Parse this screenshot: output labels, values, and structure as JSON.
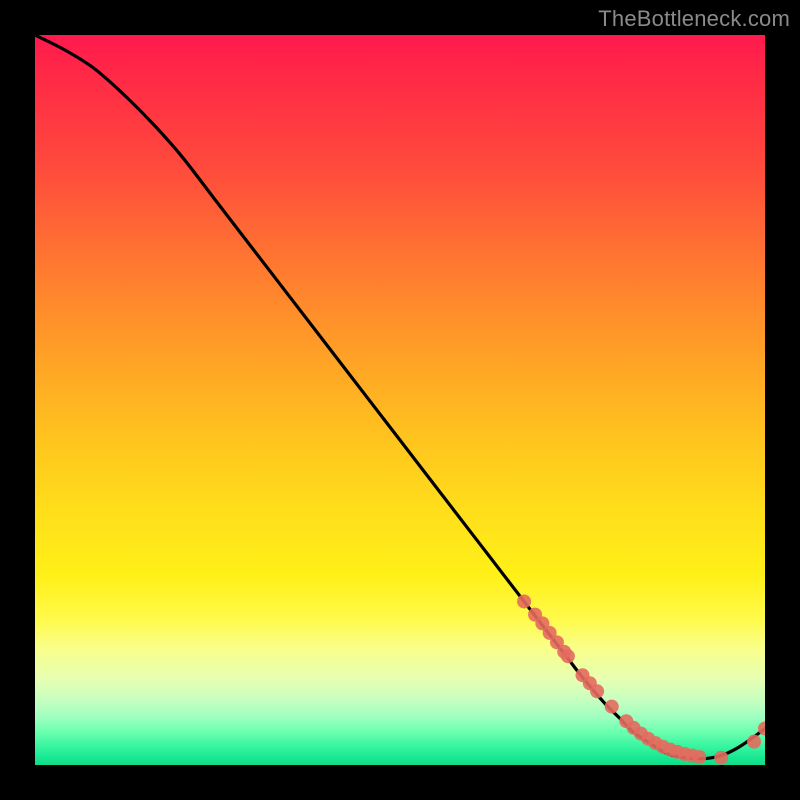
{
  "watermark": "TheBottleneck.com",
  "colors": {
    "background": "#000000",
    "curve": "#000000",
    "marker": "#e46a5e",
    "gradient_top": "#ff1a4d",
    "gradient_bottom": "#10dc88"
  },
  "chart_data": {
    "type": "line",
    "title": "",
    "xlabel": "",
    "ylabel": "",
    "xlim": [
      0,
      100
    ],
    "ylim": [
      0,
      100
    ],
    "grid": false,
    "legend": false,
    "series": [
      {
        "name": "curve",
        "x": [
          0,
          4,
          8,
          12,
          16,
          20,
          25,
          30,
          35,
          40,
          45,
          50,
          55,
          60,
          65,
          67,
          69,
          71,
          73,
          75,
          78,
          80,
          82,
          85,
          87,
          90,
          92,
          94,
          96,
          98,
          100
        ],
        "y": [
          100,
          98,
          95.5,
          92,
          88,
          83.5,
          77,
          70.5,
          64,
          57.5,
          51,
          44.5,
          38,
          31.5,
          25,
          22.4,
          19.8,
          17.2,
          14.6,
          12,
          8.5,
          6.5,
          4.5,
          2.5,
          1.4,
          0.9,
          0.9,
          1.3,
          2.2,
          3.5,
          5
        ]
      }
    ],
    "markers": {
      "name": "highlighted-points",
      "x": [
        67,
        68.5,
        69.5,
        70.5,
        71.5,
        72.5,
        73,
        75,
        76,
        77,
        79,
        81,
        82,
        83,
        84,
        85,
        86,
        87,
        88,
        89,
        90,
        91,
        94,
        98.5,
        100
      ],
      "y": [
        22.4,
        20.6,
        19.4,
        18.1,
        16.8,
        15.5,
        14.9,
        12.3,
        11.2,
        10.1,
        8,
        6,
        5.1,
        4.3,
        3.6,
        3,
        2.5,
        2.1,
        1.8,
        1.5,
        1.3,
        1.1,
        1,
        3.2,
        5
      ]
    }
  }
}
